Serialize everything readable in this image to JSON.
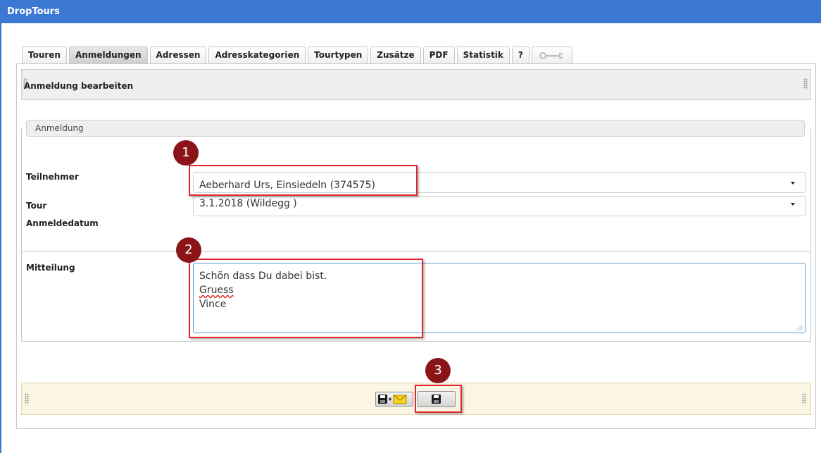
{
  "app": {
    "title": "DropTours"
  },
  "tabs": [
    {
      "label": "Touren",
      "active": false
    },
    {
      "label": "Anmeldungen",
      "active": true
    },
    {
      "label": "Adressen",
      "active": false
    },
    {
      "label": "Adresskategorien",
      "active": false
    },
    {
      "label": "Tourtypen",
      "active": false
    },
    {
      "label": "Zusätze",
      "active": false
    },
    {
      "label": "PDF",
      "active": false
    },
    {
      "label": "Statistik",
      "active": false
    },
    {
      "label": "?",
      "active": false
    }
  ],
  "panel": {
    "title": "Anmeldung bearbeiten"
  },
  "fieldset": {
    "legend": "Anmeldung"
  },
  "form": {
    "teilnehmer_label": "Teilnehmer",
    "teilnehmer_value": "Aeberhard Urs, Einsiedeln (374575)",
    "tour_label": "Tour",
    "tour_value": "3.1.2018 (Wildegg )",
    "anmeldedatum_label": "Anmeldedatum",
    "mitteilung_label": "Mitteilung",
    "mitteilung_lines": [
      "Schön dass Du dabei bist.",
      "Gruess",
      "Vince"
    ]
  },
  "annotations": {
    "badge1": "1",
    "badge2": "2",
    "badge3": "3"
  },
  "colors": {
    "titlebar": "#3a78d4",
    "annotation_red": "#e3262d",
    "badge": "#8b1418",
    "footer_bg": "#fbf6e4"
  },
  "icons": {
    "settings": "wrench-icon",
    "save_mail": "save-and-mail-icon",
    "save": "floppy-disk-icon"
  }
}
